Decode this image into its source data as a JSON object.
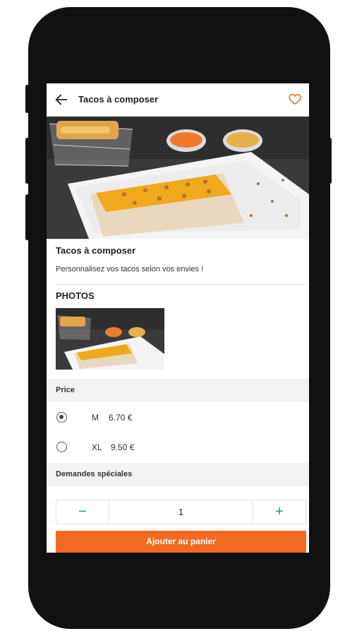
{
  "appbar": {
    "title": "Tacos à composer"
  },
  "product": {
    "name": "Tacos à composer",
    "description": "Personnalisez vos tacos selon vos envies !"
  },
  "photos": {
    "title": "PHOTOS"
  },
  "price": {
    "title": "Price",
    "options": [
      {
        "size": "M",
        "price": "6.70 €",
        "selected": true
      },
      {
        "size": "XL",
        "price": "9.50 €",
        "selected": false
      }
    ]
  },
  "special_requests": {
    "title": "Demandes spéciales"
  },
  "quantity": {
    "minus": "−",
    "value": "1",
    "plus": "+"
  },
  "cart_button": {
    "label": "Ajouter au panier"
  },
  "colors": {
    "accent": "#f26a21",
    "stepper_icon": "#2e9e4e"
  },
  "icons": [
    "back-arrow-icon",
    "heart-icon"
  ]
}
